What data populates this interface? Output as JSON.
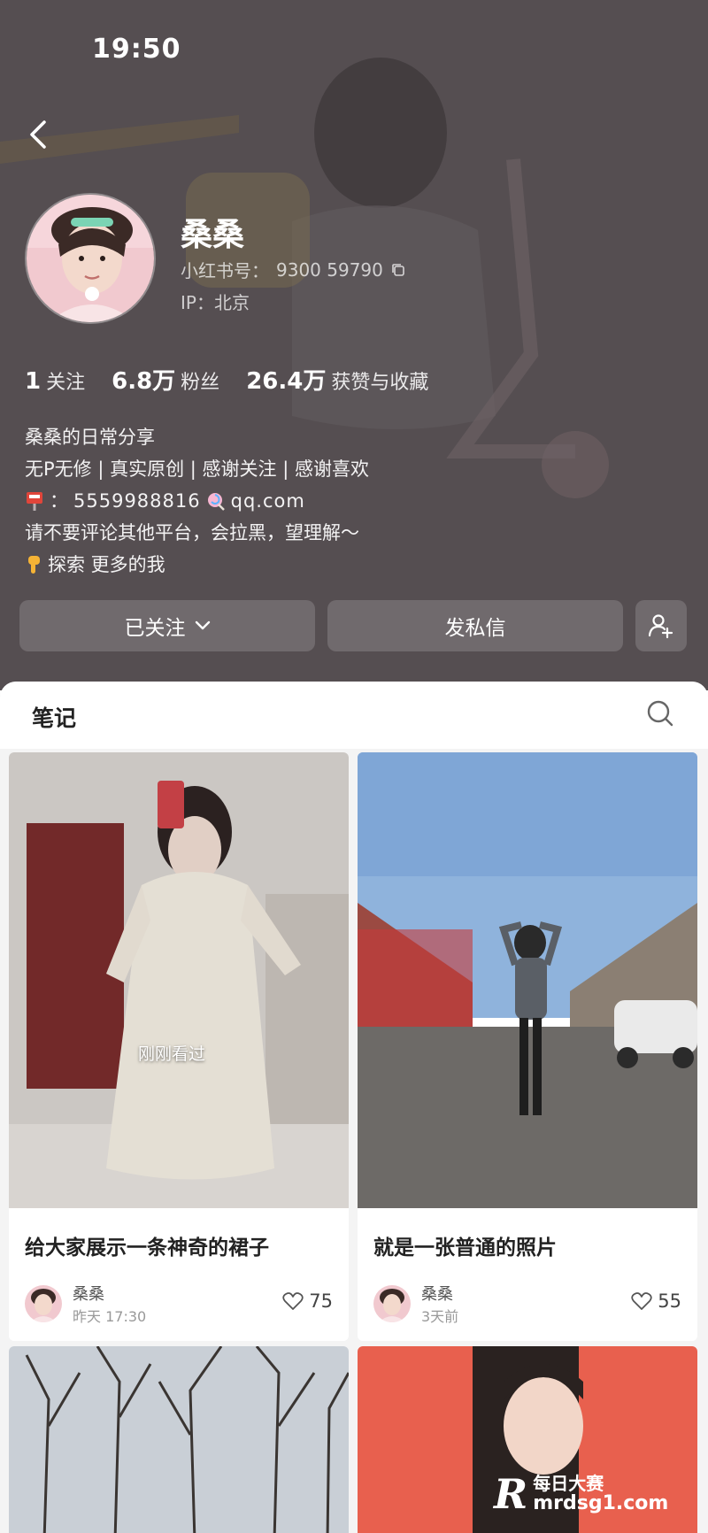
{
  "status_bar": {
    "time": "19:50"
  },
  "profile": {
    "nickname": "桑桑",
    "redid_label": "小红书号：",
    "redid_value": "9300 59790",
    "ip": "IP：北京",
    "stats": [
      {
        "value": "1",
        "label": "关注"
      },
      {
        "value": "6.8万",
        "label": "粉丝"
      },
      {
        "value": "26.4万",
        "label": "获赞与收藏"
      }
    ],
    "bio": {
      "line1": "桑桑的日常分享",
      "line2": "无P无修 | 真实原创 | 感谢关注 | 感谢喜欢",
      "email_prefix": "：",
      "email_value": "5559988816",
      "email_suffix": "qq.com",
      "line4": "请不要评论其他平台，会拉黑，望理解～",
      "line5": "探索 更多的我"
    },
    "buttons": {
      "follow": "已关注",
      "message": "发私信"
    }
  },
  "notes_tab": {
    "label": "笔记"
  },
  "notes": [
    {
      "title": "给大家展示一条神奇的裙子",
      "author": "桑桑",
      "time": "昨天 17:30",
      "likes": "75",
      "tag": "刚刚看过"
    },
    {
      "title": "就是一张普通的照片",
      "author": "桑桑",
      "time": "3天前",
      "likes": "55"
    }
  ],
  "watermark": {
    "logo": "R",
    "cn": "每日大赛",
    "url": "mrdsg1.com"
  },
  "colors": {
    "header_bg": "#5a5456",
    "panel_bg": "#f4f4f4",
    "text_primary": "#222222"
  }
}
